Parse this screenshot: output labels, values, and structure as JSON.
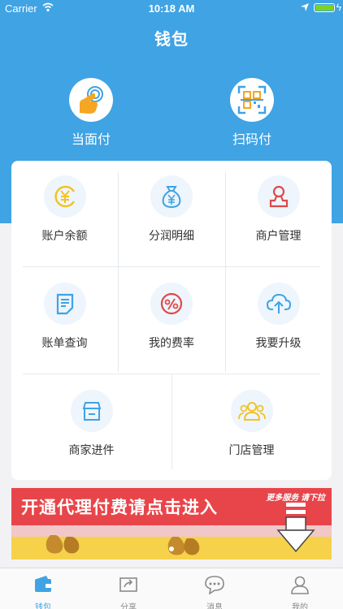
{
  "status_bar": {
    "carrier": "Carrier",
    "time": "10:18 AM"
  },
  "header": {
    "title": "钱包"
  },
  "quick_actions": [
    {
      "label": "当面付",
      "icon": "tap-hand-icon"
    },
    {
      "label": "扫码付",
      "icon": "qr-scan-icon"
    }
  ],
  "grid": {
    "items": [
      {
        "label": "账户余额",
        "icon": "yen-coin-icon"
      },
      {
        "label": "分润明细",
        "icon": "money-bag-icon"
      },
      {
        "label": "商户管理",
        "icon": "merchant-person-icon"
      },
      {
        "label": "账单查询",
        "icon": "bill-icon"
      },
      {
        "label": "我的费率",
        "icon": "percent-icon"
      },
      {
        "label": "我要升级",
        "icon": "cloud-upload-icon"
      },
      {
        "label": "商家进件",
        "icon": "store-icon"
      },
      {
        "label": "门店管理",
        "icon": "group-icon"
      }
    ]
  },
  "banner": {
    "slogan": "开通代理付费请点击进入",
    "hint": "更多服务 请下拉"
  },
  "tabbar": {
    "tabs": [
      {
        "label": "钱包",
        "icon": "wallet-icon",
        "active": true
      },
      {
        "label": "分享",
        "icon": "share-icon"
      },
      {
        "label": "消息",
        "icon": "message-icon"
      },
      {
        "label": "我的",
        "icon": "profile-icon"
      }
    ]
  },
  "colors": {
    "primary": "#3fa3e4",
    "banner_red": "#e8454a",
    "accent_gold": "#f2c322"
  }
}
